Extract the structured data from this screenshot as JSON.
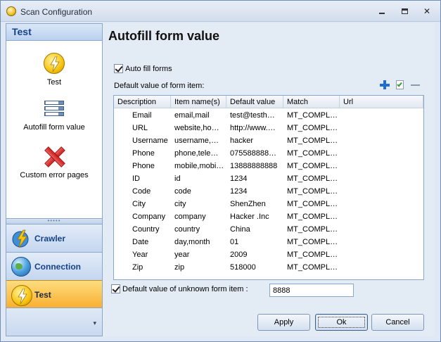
{
  "window": {
    "title": "Scan Configuration",
    "controls": {
      "minimize": "minimize",
      "maximize": "maximize",
      "close": "✕"
    }
  },
  "nav": {
    "header": "Test",
    "items": [
      {
        "label": "Test",
        "icon": "lightning-icon"
      },
      {
        "label": "Autofill form value",
        "icon": "form-items-icon"
      },
      {
        "label": "Custom error pages",
        "icon": "red-x-icon"
      }
    ],
    "splitter": "•••••",
    "groups": [
      {
        "label": "Crawler",
        "icon": "crawler-icon"
      },
      {
        "label": "Connection",
        "icon": "globe-icon"
      },
      {
        "label": "Test",
        "icon": "lightning-icon",
        "active": true
      }
    ],
    "footer_chevron": "▾"
  },
  "content": {
    "title": "Autofill form value",
    "auto_fill_label": "Auto fill forms",
    "auto_fill_checked": true,
    "default_values_label": "Default value of form item:",
    "toolbar": {
      "add": "add-icon",
      "edit": "edit-icon",
      "delete": "delete-icon"
    },
    "table": {
      "columns": [
        "Description",
        "Item name(s)",
        "Default value",
        "Match",
        "Url"
      ],
      "rows": [
        [
          "Email",
          "email,mail",
          "test@testh…",
          "MT_COMPL…",
          ""
        ],
        [
          "URL",
          "website,ho…",
          "http://www.…",
          "MT_COMPL…",
          ""
        ],
        [
          "Username",
          "username,…",
          "hacker",
          "MT_COMPL…",
          ""
        ],
        [
          "Phone",
          "phone,tele…",
          "075588888…",
          "MT_COMPL…",
          ""
        ],
        [
          "Phone",
          "mobile,mobi…",
          "13888888888",
          "MT_COMPL…",
          ""
        ],
        [
          "ID",
          "id",
          "1234",
          "MT_COMPL…",
          ""
        ],
        [
          "Code",
          "code",
          "1234",
          "MT_COMPL…",
          ""
        ],
        [
          "City",
          "city",
          "ShenZhen",
          "MT_COMPL…",
          ""
        ],
        [
          "Company",
          "company",
          "Hacker .Inc",
          "MT_COMPL…",
          ""
        ],
        [
          "Country",
          "country",
          "China",
          "MT_COMPL…",
          ""
        ],
        [
          "Date",
          "day,month",
          "01",
          "MT_COMPL…",
          ""
        ],
        [
          "Year",
          "year",
          "2009",
          "MT_COMPL…",
          ""
        ],
        [
          "Zip",
          "zip",
          "518000",
          "MT_COMPL…",
          ""
        ]
      ]
    },
    "unknown_label": "Default value of unknown form item :",
    "unknown_checked": true,
    "unknown_value": "8888",
    "buttons": {
      "apply": "Apply",
      "ok": "Ok",
      "cancel": "Cancel"
    }
  }
}
